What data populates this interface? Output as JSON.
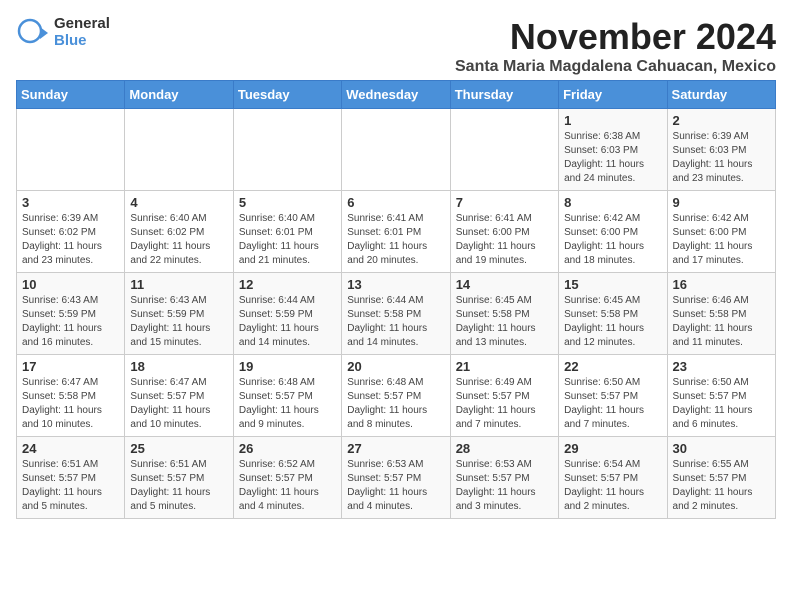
{
  "logo": {
    "general": "General",
    "blue": "Blue"
  },
  "title": {
    "month": "November 2024",
    "location": "Santa Maria Magdalena Cahuacan, Mexico"
  },
  "header": {
    "days": [
      "Sunday",
      "Monday",
      "Tuesday",
      "Wednesday",
      "Thursday",
      "Friday",
      "Saturday"
    ]
  },
  "weeks": [
    [
      {
        "day": "",
        "info": ""
      },
      {
        "day": "",
        "info": ""
      },
      {
        "day": "",
        "info": ""
      },
      {
        "day": "",
        "info": ""
      },
      {
        "day": "",
        "info": ""
      },
      {
        "day": "1",
        "info": "Sunrise: 6:38 AM\nSunset: 6:03 PM\nDaylight: 11 hours and 24 minutes."
      },
      {
        "day": "2",
        "info": "Sunrise: 6:39 AM\nSunset: 6:03 PM\nDaylight: 11 hours and 23 minutes."
      }
    ],
    [
      {
        "day": "3",
        "info": "Sunrise: 6:39 AM\nSunset: 6:02 PM\nDaylight: 11 hours and 23 minutes."
      },
      {
        "day": "4",
        "info": "Sunrise: 6:40 AM\nSunset: 6:02 PM\nDaylight: 11 hours and 22 minutes."
      },
      {
        "day": "5",
        "info": "Sunrise: 6:40 AM\nSunset: 6:01 PM\nDaylight: 11 hours and 21 minutes."
      },
      {
        "day": "6",
        "info": "Sunrise: 6:41 AM\nSunset: 6:01 PM\nDaylight: 11 hours and 20 minutes."
      },
      {
        "day": "7",
        "info": "Sunrise: 6:41 AM\nSunset: 6:00 PM\nDaylight: 11 hours and 19 minutes."
      },
      {
        "day": "8",
        "info": "Sunrise: 6:42 AM\nSunset: 6:00 PM\nDaylight: 11 hours and 18 minutes."
      },
      {
        "day": "9",
        "info": "Sunrise: 6:42 AM\nSunset: 6:00 PM\nDaylight: 11 hours and 17 minutes."
      }
    ],
    [
      {
        "day": "10",
        "info": "Sunrise: 6:43 AM\nSunset: 5:59 PM\nDaylight: 11 hours and 16 minutes."
      },
      {
        "day": "11",
        "info": "Sunrise: 6:43 AM\nSunset: 5:59 PM\nDaylight: 11 hours and 15 minutes."
      },
      {
        "day": "12",
        "info": "Sunrise: 6:44 AM\nSunset: 5:59 PM\nDaylight: 11 hours and 14 minutes."
      },
      {
        "day": "13",
        "info": "Sunrise: 6:44 AM\nSunset: 5:58 PM\nDaylight: 11 hours and 14 minutes."
      },
      {
        "day": "14",
        "info": "Sunrise: 6:45 AM\nSunset: 5:58 PM\nDaylight: 11 hours and 13 minutes."
      },
      {
        "day": "15",
        "info": "Sunrise: 6:45 AM\nSunset: 5:58 PM\nDaylight: 11 hours and 12 minutes."
      },
      {
        "day": "16",
        "info": "Sunrise: 6:46 AM\nSunset: 5:58 PM\nDaylight: 11 hours and 11 minutes."
      }
    ],
    [
      {
        "day": "17",
        "info": "Sunrise: 6:47 AM\nSunset: 5:58 PM\nDaylight: 11 hours and 10 minutes."
      },
      {
        "day": "18",
        "info": "Sunrise: 6:47 AM\nSunset: 5:57 PM\nDaylight: 11 hours and 10 minutes."
      },
      {
        "day": "19",
        "info": "Sunrise: 6:48 AM\nSunset: 5:57 PM\nDaylight: 11 hours and 9 minutes."
      },
      {
        "day": "20",
        "info": "Sunrise: 6:48 AM\nSunset: 5:57 PM\nDaylight: 11 hours and 8 minutes."
      },
      {
        "day": "21",
        "info": "Sunrise: 6:49 AM\nSunset: 5:57 PM\nDaylight: 11 hours and 7 minutes."
      },
      {
        "day": "22",
        "info": "Sunrise: 6:50 AM\nSunset: 5:57 PM\nDaylight: 11 hours and 7 minutes."
      },
      {
        "day": "23",
        "info": "Sunrise: 6:50 AM\nSunset: 5:57 PM\nDaylight: 11 hours and 6 minutes."
      }
    ],
    [
      {
        "day": "24",
        "info": "Sunrise: 6:51 AM\nSunset: 5:57 PM\nDaylight: 11 hours and 5 minutes."
      },
      {
        "day": "25",
        "info": "Sunrise: 6:51 AM\nSunset: 5:57 PM\nDaylight: 11 hours and 5 minutes."
      },
      {
        "day": "26",
        "info": "Sunrise: 6:52 AM\nSunset: 5:57 PM\nDaylight: 11 hours and 4 minutes."
      },
      {
        "day": "27",
        "info": "Sunrise: 6:53 AM\nSunset: 5:57 PM\nDaylight: 11 hours and 4 minutes."
      },
      {
        "day": "28",
        "info": "Sunrise: 6:53 AM\nSunset: 5:57 PM\nDaylight: 11 hours and 3 minutes."
      },
      {
        "day": "29",
        "info": "Sunrise: 6:54 AM\nSunset: 5:57 PM\nDaylight: 11 hours and 2 minutes."
      },
      {
        "day": "30",
        "info": "Sunrise: 6:55 AM\nSunset: 5:57 PM\nDaylight: 11 hours and 2 minutes."
      }
    ]
  ]
}
